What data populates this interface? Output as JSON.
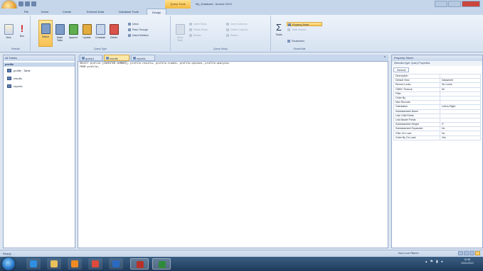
{
  "window": {
    "title": "My_Database : Access 2013",
    "context_tab": "Query Tools",
    "controls": [
      "minimize",
      "maximize",
      "close"
    ]
  },
  "quick_access": [
    "save-icon",
    "undo-icon",
    "redo-icon"
  ],
  "tabs": [
    {
      "label": "File",
      "active": false
    },
    {
      "label": "Home",
      "active": false
    },
    {
      "label": "Create",
      "active": false
    },
    {
      "label": "External Data",
      "active": false
    },
    {
      "label": "Database Tools",
      "active": false
    },
    {
      "label": "Design",
      "active": true
    }
  ],
  "ribbon": {
    "results": {
      "label": "Results",
      "buttons": [
        {
          "label": "View",
          "icon": "view-icon"
        },
        {
          "label": "Run",
          "icon": "run-icon"
        }
      ]
    },
    "query_type": {
      "label": "Query Type",
      "buttons": [
        {
          "label": "Select",
          "icon": "select-query-icon",
          "selected": true
        },
        {
          "label": "Make Table",
          "icon": "make-table-icon"
        },
        {
          "label": "Append",
          "icon": "append-icon"
        },
        {
          "label": "Update",
          "icon": "update-icon"
        },
        {
          "label": "Crosstab",
          "icon": "crosstab-icon"
        },
        {
          "label": "Delete",
          "icon": "delete-icon"
        }
      ],
      "small": [
        {
          "label": "Union"
        },
        {
          "label": "Pass-Through"
        },
        {
          "label": "Data Definition"
        }
      ]
    },
    "query_setup": {
      "label": "Query Setup",
      "small": [
        {
          "label": "Show Table",
          "enabled": false
        },
        {
          "label": "Insert Rows",
          "enabled": false
        },
        {
          "label": "Delete Rows",
          "enabled": false
        },
        {
          "label": "Builder",
          "enabled": false
        },
        {
          "label": "Insert Columns",
          "enabled": false
        },
        {
          "label": "Delete Columns",
          "enabled": false
        },
        {
          "label": "Return:",
          "enabled": false
        }
      ]
    },
    "show_hide": {
      "label": "Show/Hide",
      "totals": "Totals",
      "small": [
        {
          "label": "Property Sheet",
          "highlighted": true
        },
        {
          "label": "Table Names",
          "highlighted": false
        },
        {
          "label": "Parameters",
          "highlighted": false
        }
      ]
    }
  },
  "nav_pane": {
    "header": "All Tables",
    "group": "profile",
    "items": [
      {
        "label": "profile : Table",
        "icon": "table-icon"
      },
      {
        "label": "results",
        "icon": "query-icon"
      },
      {
        "label": "reports",
        "icon": "query-icon"
      }
    ]
  },
  "doc_tabs": [
    {
      "label": "query1",
      "active": false
    },
    {
      "label": "results",
      "active": true
    },
    {
      "label": "reports",
      "active": false
    }
  ],
  "editor": {
    "lines": [
      "SELECT profile.[INVESTOR NUMBER], profile.results, profile.trades, profile.options, profile.analysis",
      "FROM profile;"
    ]
  },
  "property_sheet": {
    "title": "Property Sheet",
    "selection": "Selection type: Query Properties",
    "tab": "General",
    "rows": [
      {
        "key": "Description",
        "value": ""
      },
      {
        "key": "Default View",
        "value": "Datasheet"
      },
      {
        "key": "Record Locks",
        "value": "No Locks"
      },
      {
        "key": "ODBC Timeout",
        "value": "60"
      },
      {
        "key": "Filter",
        "value": ""
      },
      {
        "key": "Order By",
        "value": ""
      },
      {
        "key": "Max Records",
        "value": ""
      },
      {
        "key": "Orientation",
        "value": "Left-to-Right"
      },
      {
        "key": "Subdatasheet Name",
        "value": ""
      },
      {
        "key": "Link Child Fields",
        "value": ""
      },
      {
        "key": "Link Master Fields",
        "value": ""
      },
      {
        "key": "Subdatasheet Height",
        "value": "0\""
      },
      {
        "key": "Subdatasheet Expanded",
        "value": "No"
      },
      {
        "key": "Filter On Load",
        "value": "No"
      },
      {
        "key": "Order By On Load",
        "value": "Yes"
      }
    ]
  },
  "status": {
    "left": "Ready",
    "right": "Num Lock    Filtered"
  },
  "taskbar": {
    "apps": [
      {
        "icon": "internet-explorer-icon",
        "state": "pinned",
        "color": "#2f8fe0"
      },
      {
        "icon": "file-explorer-icon",
        "state": "pinned",
        "color": "#e8c15a"
      },
      {
        "icon": "media-player-icon",
        "state": "pinned",
        "color": "#f08a24"
      },
      {
        "icon": "chrome-icon",
        "state": "pinned",
        "color": "#dd4a3c"
      },
      {
        "icon": "outlook-icon",
        "state": "pinned",
        "color": "#2a69c2"
      },
      {
        "icon": "access-icon",
        "state": "open",
        "color": "#b7312a"
      },
      {
        "icon": "excel-icon",
        "state": "open",
        "color": "#2f8a3b"
      }
    ],
    "clock_time": "10:48",
    "clock_date": "10/21/2013"
  }
}
